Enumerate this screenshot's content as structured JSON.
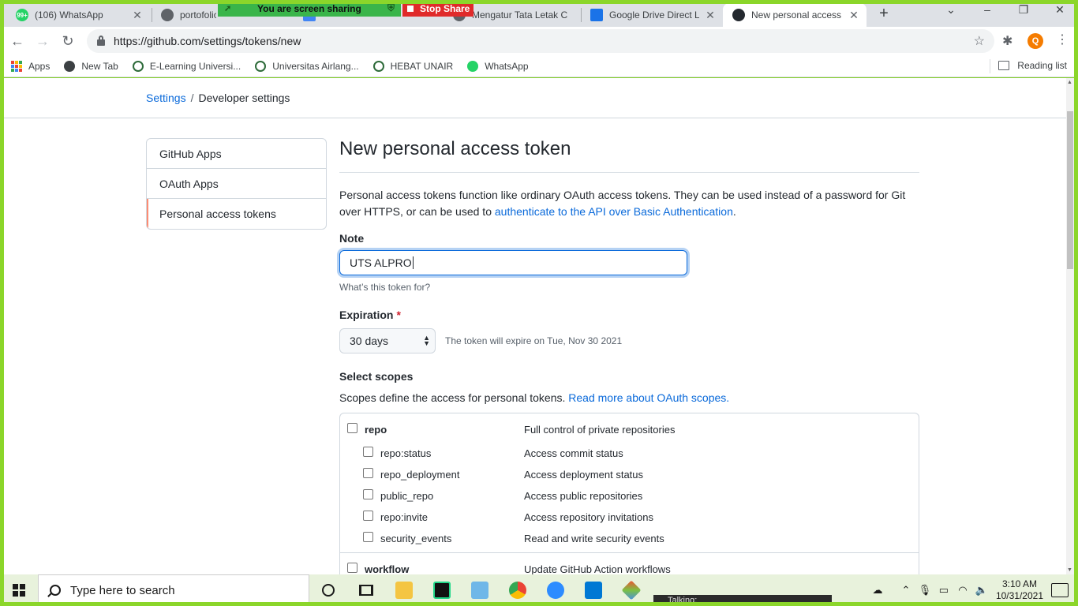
{
  "share": {
    "banner_label": "You are screen sharing",
    "stop_label": "Stop Share"
  },
  "tabs": [
    {
      "label": "(106) WhatsApp",
      "icon": "whatsapp-icon",
      "badge": "99+"
    },
    {
      "label": "portofolio",
      "icon": "globe-icon"
    },
    {
      "label": "",
      "icon": "docs-icon"
    },
    {
      "label": "Mengatur Tata Letak C",
      "icon": "globe-icon"
    },
    {
      "label": "Google Drive Direct Li",
      "icon": "drive-icon"
    },
    {
      "label": "New personal access t",
      "icon": "github-icon"
    }
  ],
  "toolbar": {
    "url": "https://github.com/settings/tokens/new",
    "profile_initial": "Q"
  },
  "bookmarks": {
    "items": [
      {
        "label": "Apps"
      },
      {
        "label": "New Tab"
      },
      {
        "label": "E-Learning Universi..."
      },
      {
        "label": "Universitas Airlang..."
      },
      {
        "label": "HEBAT UNAIR"
      },
      {
        "label": "WhatsApp"
      }
    ],
    "reading_list": "Reading list"
  },
  "breadcrumb": {
    "settings": "Settings",
    "separator": "/",
    "current": "Developer settings"
  },
  "sidenav": {
    "items": [
      {
        "label": "GitHub Apps"
      },
      {
        "label": "OAuth Apps"
      },
      {
        "label": "Personal access tokens"
      }
    ]
  },
  "main": {
    "title": "New personal access token",
    "description": "Personal access tokens function like ordinary OAuth access tokens. They can be used instead of a password for Git over HTTPS, or can be used to ",
    "description_link": "authenticate to the API over Basic Authentication",
    "description_end": ".",
    "note_label": "Note",
    "note_value": "UTS ALPRO",
    "note_hint": "What’s this token for?",
    "expiration_label": "Expiration",
    "required_mark": "*",
    "expiration_value": "30 days",
    "expiration_note": "The token will expire on Tue, Nov 30 2021",
    "scopes_label": "Select scopes",
    "scopes_desc": "Scopes define the access for personal tokens. ",
    "scopes_link": "Read more about OAuth scopes."
  },
  "scopes": {
    "repo": {
      "name": "repo",
      "desc": "Full control of private repositories"
    },
    "repo_children": [
      {
        "name": "repo:status",
        "desc": "Access commit status"
      },
      {
        "name": "repo_deployment",
        "desc": "Access deployment status"
      },
      {
        "name": "public_repo",
        "desc": "Access public repositories"
      },
      {
        "name": "repo:invite",
        "desc": "Access repository invitations"
      },
      {
        "name": "security_events",
        "desc": "Read and write security events"
      }
    ],
    "workflow": {
      "name": "workflow",
      "desc": "Update GitHub Action workflows"
    }
  },
  "taskbar": {
    "search_placeholder": "Type here to search",
    "time": "3:10 AM",
    "date": "10/31/2021",
    "talking": "Talking:"
  },
  "colors": {
    "share_frame": "#8bd62a",
    "link": "#0969da",
    "active_nav": "#fd8c73"
  }
}
